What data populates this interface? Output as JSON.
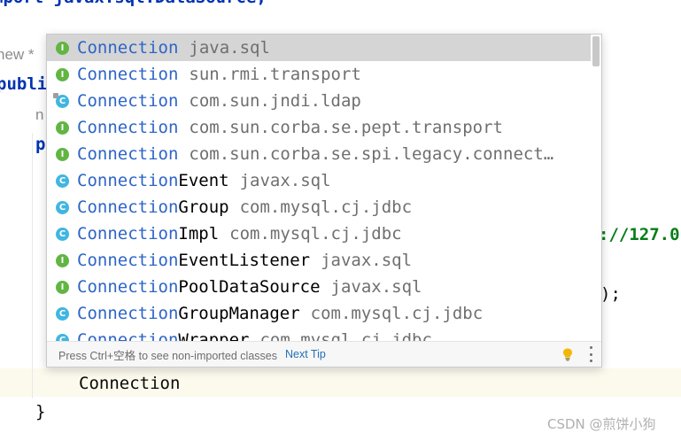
{
  "editor": {
    "line_import": "mport javax.sql.DataSource;",
    "line_new": "new *",
    "line_public": "publi",
    "line_n": "n",
    "line_p": "p",
    "string_fragment": "://127.0",
    "paren_fragment": ");",
    "typed_text": "Connection",
    "closing_brace": "}"
  },
  "popup": {
    "items": [
      {
        "kind": "I",
        "match": "Connection",
        "rest": "",
        "pkg": "java.sql",
        "selected": true
      },
      {
        "kind": "I",
        "match": "Connection",
        "rest": "",
        "pkg": "sun.rmi.transport"
      },
      {
        "kind": "C",
        "match": "Connection",
        "rest": "",
        "pkg": "com.sun.jndi.ldap",
        "locked": true
      },
      {
        "kind": "I",
        "match": "Connection",
        "rest": "",
        "pkg": "com.sun.corba.se.pept.transport"
      },
      {
        "kind": "I",
        "match": "Connection",
        "rest": "",
        "pkg": "com.sun.corba.se.spi.legacy.connect…"
      },
      {
        "kind": "C",
        "match": "Connection",
        "rest": "Event",
        "pkg": "javax.sql"
      },
      {
        "kind": "C",
        "match": "Connection",
        "rest": "Group",
        "pkg": "com.mysql.cj.jdbc"
      },
      {
        "kind": "C",
        "match": "Connection",
        "rest": "Impl",
        "pkg": "com.mysql.cj.jdbc"
      },
      {
        "kind": "I",
        "match": "Connection",
        "rest": "EventListener",
        "pkg": "javax.sql"
      },
      {
        "kind": "I",
        "match": "Connection",
        "rest": "PoolDataSource",
        "pkg": "javax.sql"
      },
      {
        "kind": "C",
        "match": "Connection",
        "rest": "GroupManager",
        "pkg": "com.mysql.cj.jdbc"
      },
      {
        "kind": "C",
        "match": "Connection",
        "rest": "Wrapper",
        "pkg": "com.mysql.cj.jdbc"
      }
    ],
    "footer_hint": "Press Ctrl+空格 to see non-imported classes",
    "footer_link": "Next Tip",
    "bulb_icon": "lightbulb-icon",
    "more_icon": "more-vertical-icon"
  },
  "watermark": "CSDN @煎饼小狗",
  "colors": {
    "match": "#2e65c6",
    "interface_badge": "#62b543",
    "class_badge": "#40b6e0",
    "selected_row": "#d5d5d5"
  }
}
